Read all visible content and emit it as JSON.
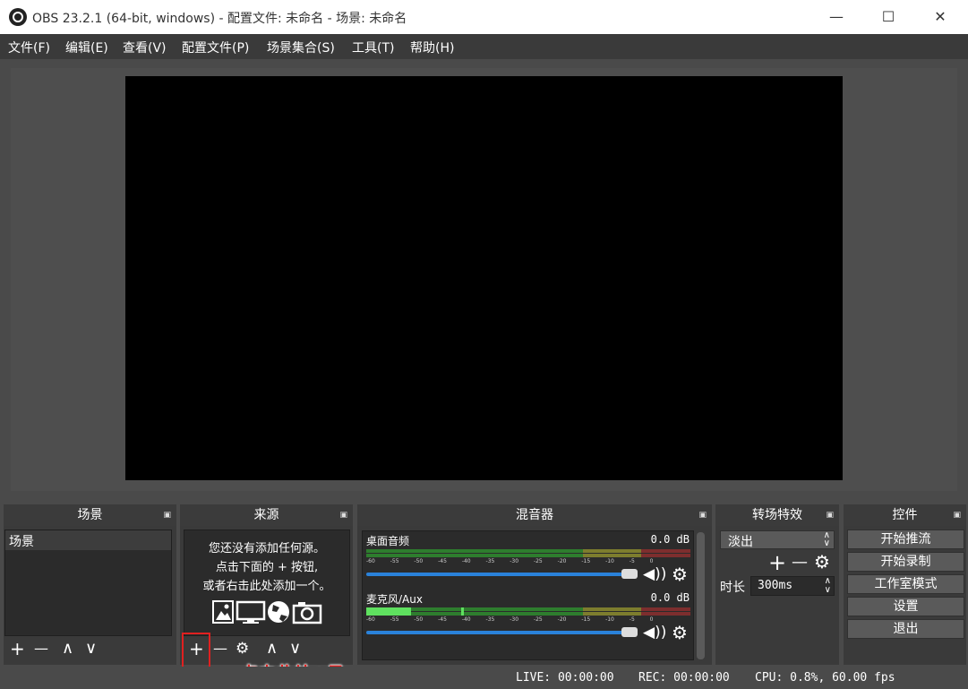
{
  "window": {
    "title": "OBS 23.2.1 (64-bit, windows) - 配置文件: 未命名 - 场景: 未命名",
    "minimize": "—",
    "maximize": "☐",
    "close": "✕"
  },
  "menu": [
    "文件(F)",
    "编辑(E)",
    "查看(V)",
    "配置文件(P)",
    "场景集合(S)",
    "工具(T)",
    "帮助(H)"
  ],
  "docks": {
    "scenes": {
      "title": "场景",
      "items": [
        "场景"
      ]
    },
    "sources": {
      "title": "来源",
      "empty_line1": "您还没有添加任何源。",
      "empty_line2": "点击下面的 + 按钮,",
      "empty_line3": "或者右击此处添加一个。"
    },
    "mixer": {
      "title": "混音器",
      "channels": [
        {
          "name": "桌面音频",
          "level": "0.0 dB",
          "volume": 0.97
        },
        {
          "name": "麦克风/Aux",
          "level": "0.0 dB",
          "volume": 0.97
        }
      ],
      "ticks": "-60 -55 -50 -45 -40 -35 -30 -25 -20 -15 -10 -5 0"
    },
    "transitions": {
      "title": "转场特效",
      "selected": "淡出",
      "duration_label": "时长",
      "duration_value": "300ms"
    },
    "controls": {
      "title": "控件",
      "buttons": [
        "开始推流",
        "开始录制",
        "工作室模式",
        "设置",
        "退出"
      ]
    }
  },
  "annotation": {
    "text": "点击此处+号",
    "color": "#e02020"
  },
  "status": {
    "live": "LIVE: 00:00:00",
    "rec": "REC: 00:00:00",
    "cpu": "CPU: 0.8%, 60.00 fps"
  },
  "icons": {
    "add": "+",
    "remove": "—",
    "up": "∧",
    "down": "∨",
    "settings": "⚙",
    "speaker": "🔊"
  }
}
